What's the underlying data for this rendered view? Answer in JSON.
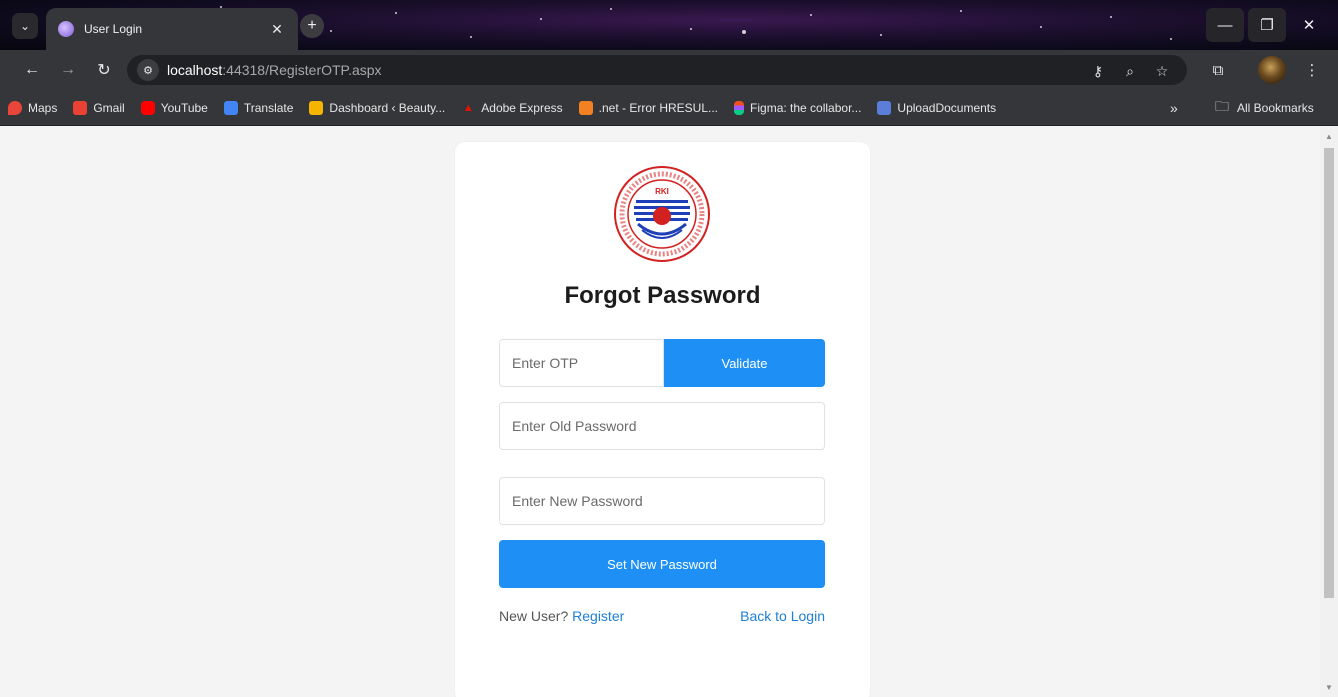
{
  "browser": {
    "tab_title": "User Login",
    "url_host": "localhost",
    "url_rest": ":44318/RegisterOTP.aspx",
    "bookmarks": [
      {
        "label": "Maps",
        "icon": "maps-icon",
        "color": "#e9453a"
      },
      {
        "label": "Gmail",
        "icon": "gmail-icon",
        "color": "#ea4335"
      },
      {
        "label": "YouTube",
        "icon": "youtube-icon",
        "color": "#ff0000"
      },
      {
        "label": "Translate",
        "icon": "translate-icon",
        "color": "#4285f4"
      },
      {
        "label": "Dashboard ‹ Beauty...",
        "icon": "dashboard-icon",
        "color": "#f4b400"
      },
      {
        "label": "Adobe Express",
        "icon": "adobe-icon",
        "color": "#eb1000"
      },
      {
        "label": ".net - Error HRESUL...",
        "icon": "stackoverflow-icon",
        "color": "#f48024"
      },
      {
        "label": "Figma: the collabor...",
        "icon": "figma-icon",
        "color": "#a259ff"
      },
      {
        "label": "UploadDocuments",
        "icon": "upload-icon",
        "color": "#5b7fd9"
      }
    ],
    "more_bookmarks": "»",
    "all_bookmarks": "All Bookmarks"
  },
  "page": {
    "title": "Forgot Password",
    "otp_placeholder": "Enter OTP",
    "validate_label": "Validate",
    "old_password_placeholder": "Enter Old Password",
    "new_password_placeholder": "Enter New Password",
    "set_password_label": "Set New Password",
    "new_user_text": "New User?",
    "register_link": "Register",
    "back_to_login_link": "Back to Login"
  },
  "colors": {
    "primary": "#1e90f5",
    "link": "#1e7fd6"
  }
}
